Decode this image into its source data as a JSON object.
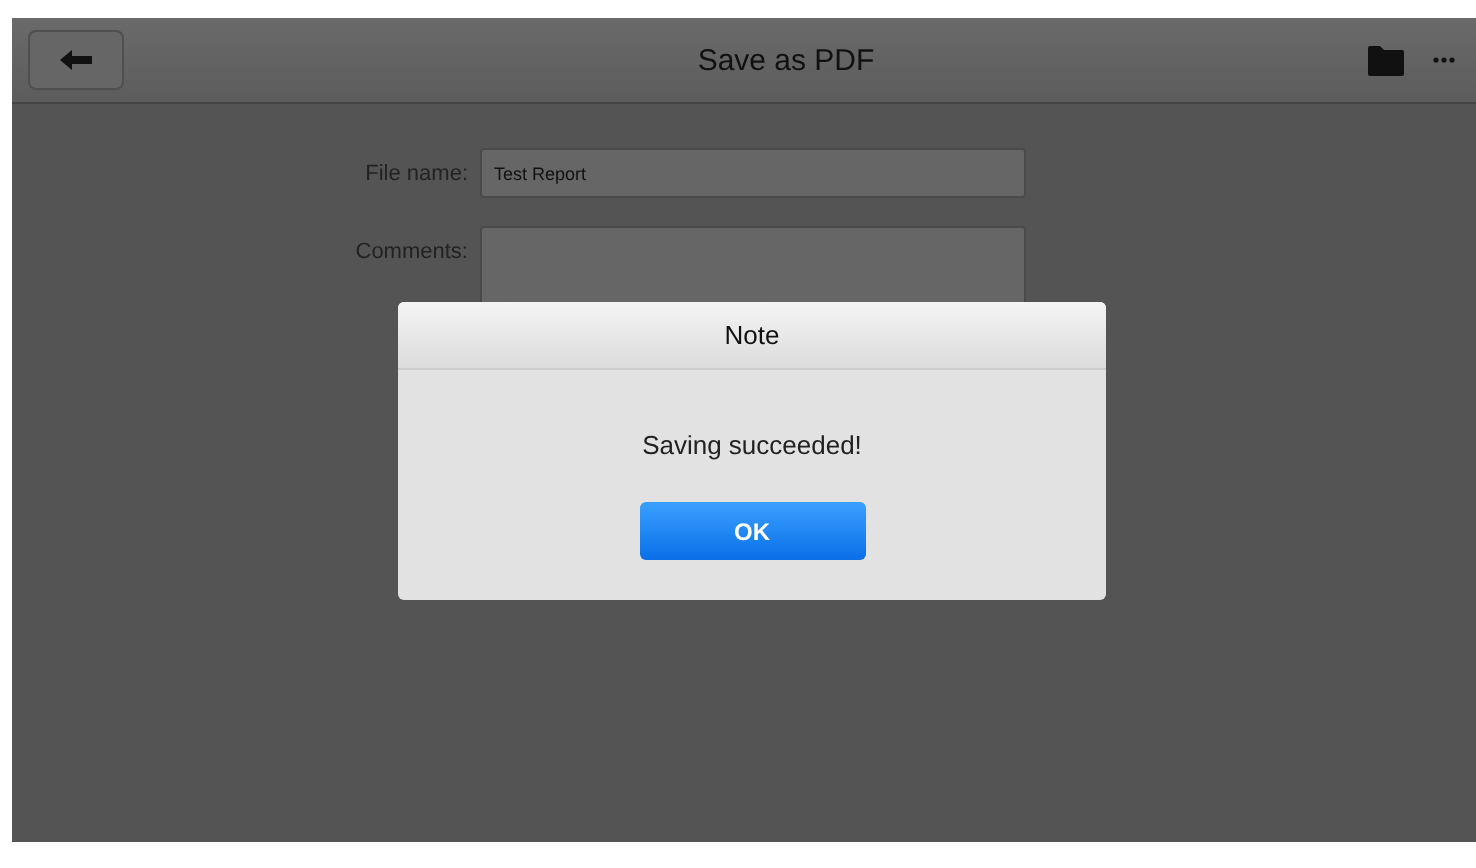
{
  "top_bar": {
    "title": "Save as PDF"
  },
  "form": {
    "fields": [
      {
        "label": "File name:",
        "value": "Test Report",
        "kind": "line"
      },
      {
        "label": "Comments:",
        "kind": "area"
      }
    ]
  },
  "dialog": {
    "title": "Note",
    "message": "Saving succeeded!",
    "button": "OK"
  }
}
